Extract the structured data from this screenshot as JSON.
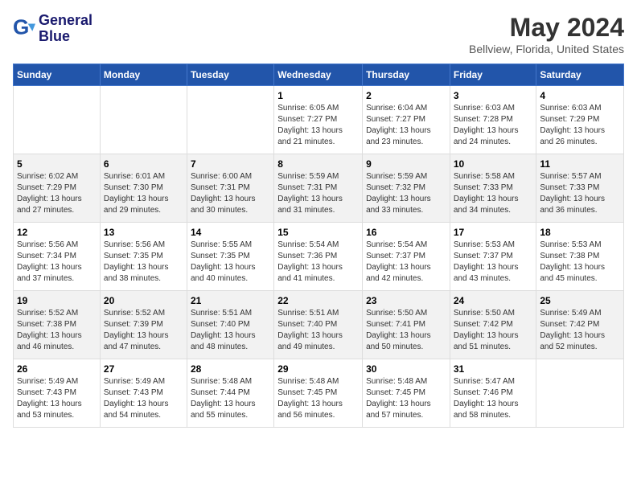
{
  "header": {
    "logo_line1": "General",
    "logo_line2": "Blue",
    "title": "May 2024",
    "subtitle": "Bellview, Florida, United States"
  },
  "calendar": {
    "columns": [
      "Sunday",
      "Monday",
      "Tuesday",
      "Wednesday",
      "Thursday",
      "Friday",
      "Saturday"
    ],
    "weeks": [
      [
        {
          "day": "",
          "info": ""
        },
        {
          "day": "",
          "info": ""
        },
        {
          "day": "",
          "info": ""
        },
        {
          "day": "1",
          "info": "Sunrise: 6:05 AM\nSunset: 7:27 PM\nDaylight: 13 hours\nand 21 minutes."
        },
        {
          "day": "2",
          "info": "Sunrise: 6:04 AM\nSunset: 7:27 PM\nDaylight: 13 hours\nand 23 minutes."
        },
        {
          "day": "3",
          "info": "Sunrise: 6:03 AM\nSunset: 7:28 PM\nDaylight: 13 hours\nand 24 minutes."
        },
        {
          "day": "4",
          "info": "Sunrise: 6:03 AM\nSunset: 7:29 PM\nDaylight: 13 hours\nand 26 minutes."
        }
      ],
      [
        {
          "day": "5",
          "info": "Sunrise: 6:02 AM\nSunset: 7:29 PM\nDaylight: 13 hours\nand 27 minutes."
        },
        {
          "day": "6",
          "info": "Sunrise: 6:01 AM\nSunset: 7:30 PM\nDaylight: 13 hours\nand 29 minutes."
        },
        {
          "day": "7",
          "info": "Sunrise: 6:00 AM\nSunset: 7:31 PM\nDaylight: 13 hours\nand 30 minutes."
        },
        {
          "day": "8",
          "info": "Sunrise: 5:59 AM\nSunset: 7:31 PM\nDaylight: 13 hours\nand 31 minutes."
        },
        {
          "day": "9",
          "info": "Sunrise: 5:59 AM\nSunset: 7:32 PM\nDaylight: 13 hours\nand 33 minutes."
        },
        {
          "day": "10",
          "info": "Sunrise: 5:58 AM\nSunset: 7:33 PM\nDaylight: 13 hours\nand 34 minutes."
        },
        {
          "day": "11",
          "info": "Sunrise: 5:57 AM\nSunset: 7:33 PM\nDaylight: 13 hours\nand 36 minutes."
        }
      ],
      [
        {
          "day": "12",
          "info": "Sunrise: 5:56 AM\nSunset: 7:34 PM\nDaylight: 13 hours\nand 37 minutes."
        },
        {
          "day": "13",
          "info": "Sunrise: 5:56 AM\nSunset: 7:35 PM\nDaylight: 13 hours\nand 38 minutes."
        },
        {
          "day": "14",
          "info": "Sunrise: 5:55 AM\nSunset: 7:35 PM\nDaylight: 13 hours\nand 40 minutes."
        },
        {
          "day": "15",
          "info": "Sunrise: 5:54 AM\nSunset: 7:36 PM\nDaylight: 13 hours\nand 41 minutes."
        },
        {
          "day": "16",
          "info": "Sunrise: 5:54 AM\nSunset: 7:37 PM\nDaylight: 13 hours\nand 42 minutes."
        },
        {
          "day": "17",
          "info": "Sunrise: 5:53 AM\nSunset: 7:37 PM\nDaylight: 13 hours\nand 43 minutes."
        },
        {
          "day": "18",
          "info": "Sunrise: 5:53 AM\nSunset: 7:38 PM\nDaylight: 13 hours\nand 45 minutes."
        }
      ],
      [
        {
          "day": "19",
          "info": "Sunrise: 5:52 AM\nSunset: 7:38 PM\nDaylight: 13 hours\nand 46 minutes."
        },
        {
          "day": "20",
          "info": "Sunrise: 5:52 AM\nSunset: 7:39 PM\nDaylight: 13 hours\nand 47 minutes."
        },
        {
          "day": "21",
          "info": "Sunrise: 5:51 AM\nSunset: 7:40 PM\nDaylight: 13 hours\nand 48 minutes."
        },
        {
          "day": "22",
          "info": "Sunrise: 5:51 AM\nSunset: 7:40 PM\nDaylight: 13 hours\nand 49 minutes."
        },
        {
          "day": "23",
          "info": "Sunrise: 5:50 AM\nSunset: 7:41 PM\nDaylight: 13 hours\nand 50 minutes."
        },
        {
          "day": "24",
          "info": "Sunrise: 5:50 AM\nSunset: 7:42 PM\nDaylight: 13 hours\nand 51 minutes."
        },
        {
          "day": "25",
          "info": "Sunrise: 5:49 AM\nSunset: 7:42 PM\nDaylight: 13 hours\nand 52 minutes."
        }
      ],
      [
        {
          "day": "26",
          "info": "Sunrise: 5:49 AM\nSunset: 7:43 PM\nDaylight: 13 hours\nand 53 minutes."
        },
        {
          "day": "27",
          "info": "Sunrise: 5:49 AM\nSunset: 7:43 PM\nDaylight: 13 hours\nand 54 minutes."
        },
        {
          "day": "28",
          "info": "Sunrise: 5:48 AM\nSunset: 7:44 PM\nDaylight: 13 hours\nand 55 minutes."
        },
        {
          "day": "29",
          "info": "Sunrise: 5:48 AM\nSunset: 7:45 PM\nDaylight: 13 hours\nand 56 minutes."
        },
        {
          "day": "30",
          "info": "Sunrise: 5:48 AM\nSunset: 7:45 PM\nDaylight: 13 hours\nand 57 minutes."
        },
        {
          "day": "31",
          "info": "Sunrise: 5:47 AM\nSunset: 7:46 PM\nDaylight: 13 hours\nand 58 minutes."
        },
        {
          "day": "",
          "info": ""
        }
      ]
    ]
  }
}
